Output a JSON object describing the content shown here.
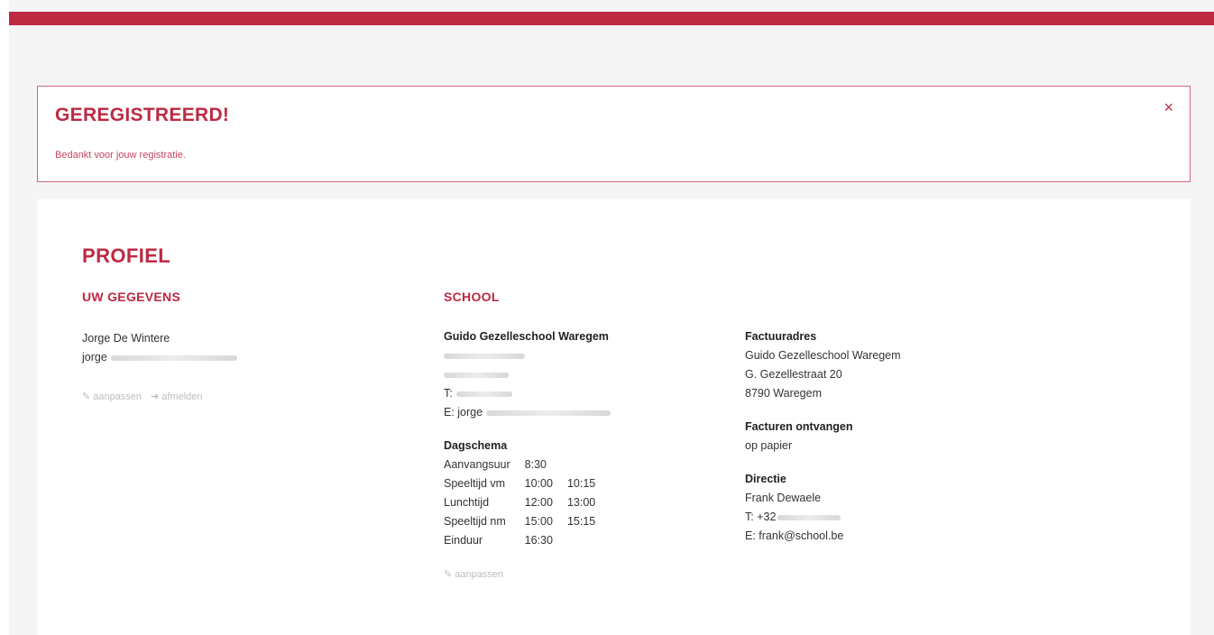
{
  "alert": {
    "title": "GEREGISTREERD!",
    "message": "Bedankt voor jouw registratie.",
    "close_symbol": "×"
  },
  "profile": {
    "title": "PROFIEL",
    "user": {
      "heading": "UW GEGEVENS",
      "name": "Jorge De Wintere",
      "email_prefix": "jorge",
      "edit_label": "aanpassen",
      "logout_label": "afmelden",
      "edit_icon": "pencil-icon",
      "logout_icon": "sign-out-icon"
    },
    "school": {
      "heading": "SCHOOL",
      "name": "Guido Gezelleschool Waregem",
      "phone_label": "T:",
      "email_label": "E: jorge",
      "schedule": {
        "title": "Dagschema",
        "rows": [
          {
            "label": "Aanvangsuur",
            "start": "8:30",
            "end": ""
          },
          {
            "label": "Speeltijd vm",
            "start": "10:00",
            "end": "10:15"
          },
          {
            "label": "Lunchtijd",
            "start": "12:00",
            "end": "13:00"
          },
          {
            "label": "Speeltijd nm",
            "start": "15:00",
            "end": "15:15"
          },
          {
            "label": "Einduur",
            "start": "16:30",
            "end": ""
          }
        ]
      },
      "edit_label": "aanpassen"
    },
    "billing": {
      "heading": "Factuuradres",
      "name": "Guido Gezelleschool Waregem",
      "street": "G. Gezellestraat 20",
      "city": "8790 Waregem",
      "invoice_heading": "Facturen ontvangen",
      "invoice_value": "op papier",
      "direction_heading": "Directie",
      "director_name": "Frank Dewaele",
      "director_phone": "T: +32",
      "director_email": "E: frank@school.be"
    }
  },
  "colors": {
    "accent": "#bd2a42",
    "background": "#f5f5f5"
  }
}
